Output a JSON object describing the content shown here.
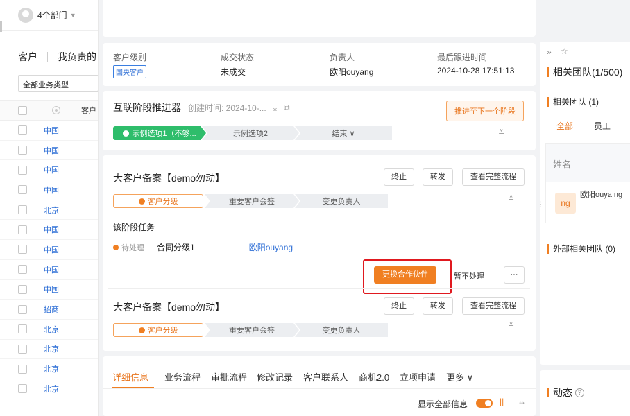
{
  "left": {
    "dept_selector": "4个部门",
    "tabs": [
      "客户",
      "我负责的"
    ],
    "business_type": "全部业务类型",
    "column_header": "客户",
    "rows": [
      "中国",
      "中国",
      "中国",
      "中国",
      "北京",
      "中国",
      "中国",
      "中国",
      "中国",
      "招商",
      "北京",
      "北京",
      "北京",
      "北京"
    ]
  },
  "info": {
    "cols": [
      {
        "label": "客户级别",
        "value": "国央客户",
        "tag": true
      },
      {
        "label": "成交状态",
        "value": "未成交"
      },
      {
        "label": "负责人",
        "value": "欧阳ouyang"
      },
      {
        "label": "最后跟进时间",
        "value": "2024-10-28 17:51:13"
      }
    ]
  },
  "stage": {
    "title": "互联阶段推进器",
    "created": "创建时间: 2024-10-...",
    "advance_btn": "推进至下一个阶段",
    "steps": [
      "示例选项1（不够...",
      "示例选项2",
      "结束 ∨"
    ]
  },
  "process1": {
    "title": "大客户备案【demo勿动】",
    "buttons": {
      "stop": "终止",
      "forward": "转发",
      "view": "查看完整流程"
    },
    "steps": [
      "客户分级",
      "重要客户会签",
      "变更负责人"
    ],
    "task_section": "该阶段任务",
    "task_status": "待处理",
    "task_name": "合同分级1",
    "task_owner": "欧阳ouyang",
    "change_partner": "更换合作伙伴",
    "skip": "暂不处理",
    "more": "···"
  },
  "process2": {
    "title": "大客户备案【demo勿动】",
    "buttons": {
      "stop": "终止",
      "forward": "转发",
      "view": "查看完整流程"
    },
    "steps": [
      "客户分级",
      "重要客户会签",
      "变更负责人"
    ]
  },
  "tabs": {
    "items": [
      "详细信息",
      "业务流程",
      "审批流程",
      "修改记录",
      "客户联系人",
      "商机2.0",
      "立项申请",
      "更多 ∨"
    ],
    "show_all": "显示全部信息"
  },
  "right": {
    "related_team": "相关团队(1/500)",
    "related_team_sub": "相关团队 (1)",
    "filter": [
      "全部",
      "员工"
    ],
    "name_header": "姓名",
    "member_avatar": "ng",
    "member_name": "欧阳ouya ng",
    "external": "外部相关团队 (0)",
    "activity": "动态"
  },
  "colors": {
    "accent": "#f07f22",
    "link": "#2f6fd6",
    "success": "#2ebd6b",
    "highlight": "#e0191f"
  }
}
